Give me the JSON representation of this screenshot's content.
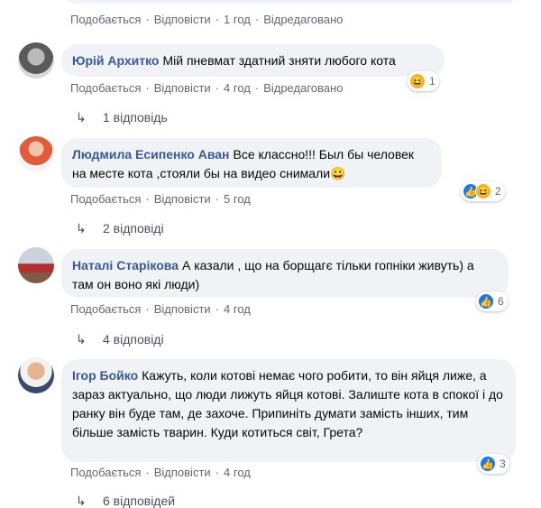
{
  "top_comment": {
    "actions": {
      "like": "Подобається",
      "reply": "Відповісти",
      "time": "1 год",
      "edited": "Відредаговано"
    }
  },
  "comments": [
    {
      "author": "Юрій Архитко",
      "text": "Мій пневмат здатний зняти любого кота",
      "actions": {
        "like": "Подобається",
        "reply": "Відповісти",
        "time": "4 год",
        "edited": "Відредаговано"
      },
      "reaction_count": "1",
      "reaction_icons": [
        "haha-icon"
      ],
      "replies": "1 відповідь"
    },
    {
      "author": "Людмила Есипенко Аван",
      "text": "Все классно!!! Был бы человек на месте кота ,стояли бы на видео снимали😀",
      "actions": {
        "like": "Подобається",
        "reply": "Відповісти",
        "time": "5 год"
      },
      "reaction_count": "2",
      "reaction_icons": [
        "like-icon",
        "haha-icon"
      ],
      "replies": "2 відповіді"
    },
    {
      "author": "Наталі Старікова",
      "text": "А казали , що на борщагє тільки гопніки живуть) а там он воно які люди)",
      "actions": {
        "like": "Подобається",
        "reply": "Відповісти",
        "time": "4 год"
      },
      "reaction_count": "6",
      "reaction_icons": [
        "like-icon"
      ],
      "replies": "4 відповіді"
    },
    {
      "author": "Ігор Бойко",
      "text": "Кажуть, коли котові немає чого робити, то він яйця лиже, а зараз актуально, що люди лижуть яйця котові. Залиште кота в спокої і до ранку він буде там, де захоче. Припиніть думати замість інших, тим більше замість тварин. Куди котиться світ, Грета?",
      "actions": {
        "like": "Подобається",
        "reply": "Відповісти",
        "time": "4 год"
      },
      "reaction_count": "3",
      "reaction_icons": [
        "like-icon"
      ],
      "replies": "6 відповідей"
    }
  ],
  "colors": {
    "author": "#385898",
    "bubble": "#f0f2f5",
    "meta": "#65676b",
    "like": "#1877f2",
    "haha": "#f7b125"
  }
}
